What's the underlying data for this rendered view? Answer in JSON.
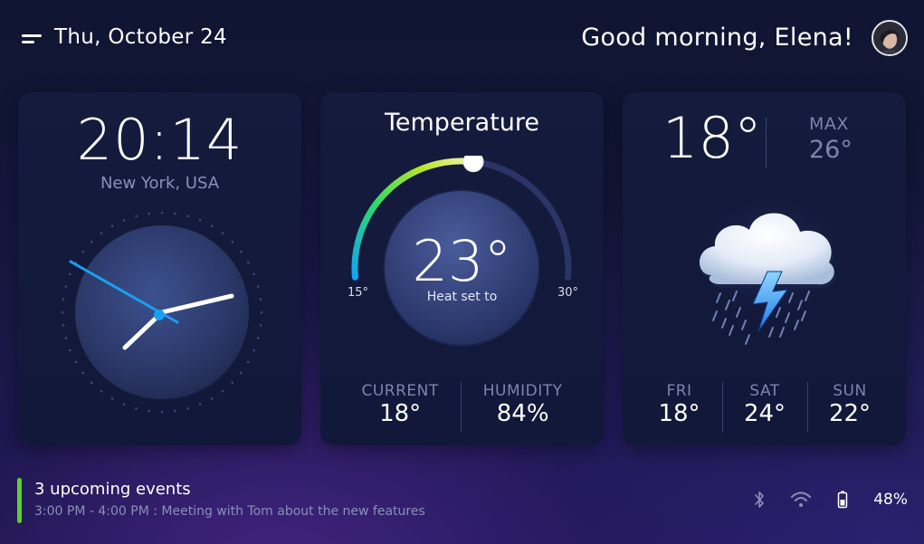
{
  "header": {
    "date": "Thu, October 24",
    "greeting": "Good morning, Elena!"
  },
  "clock": {
    "time": "20:14",
    "location": "New York, USA"
  },
  "thermostat": {
    "title": "Temperature",
    "set_value": "23°",
    "set_caption": "Heat set to",
    "min_label": "15°",
    "max_label": "30°",
    "range_min": 15,
    "range_max": 30,
    "set_temp": 23,
    "current_label": "CURRENT",
    "current_value": "18°",
    "humidity_label": "HUMIDITY",
    "humidity_value": "84%"
  },
  "weather": {
    "temp": "18°",
    "max_label": "MAX",
    "max_value": "26°",
    "icon": "thunderstorm-rain-icon",
    "forecast": [
      {
        "day": "FRI",
        "temp": "18°"
      },
      {
        "day": "SAT",
        "temp": "24°"
      },
      {
        "day": "SUN",
        "temp": "22°"
      }
    ]
  },
  "events": {
    "title": "3 upcoming events",
    "detail": "3:00 PM - 4:00 PM : Meeting with Tom about the new features"
  },
  "status": {
    "battery": "48%",
    "icons": [
      "bluetooth-icon",
      "wifi-icon",
      "battery-icon"
    ]
  },
  "colors": {
    "accent_blue": "#1aa0f0",
    "accent_green": "#5bd12b",
    "gauge_track": "#2b3466",
    "muted_text": "#7d84ad"
  }
}
